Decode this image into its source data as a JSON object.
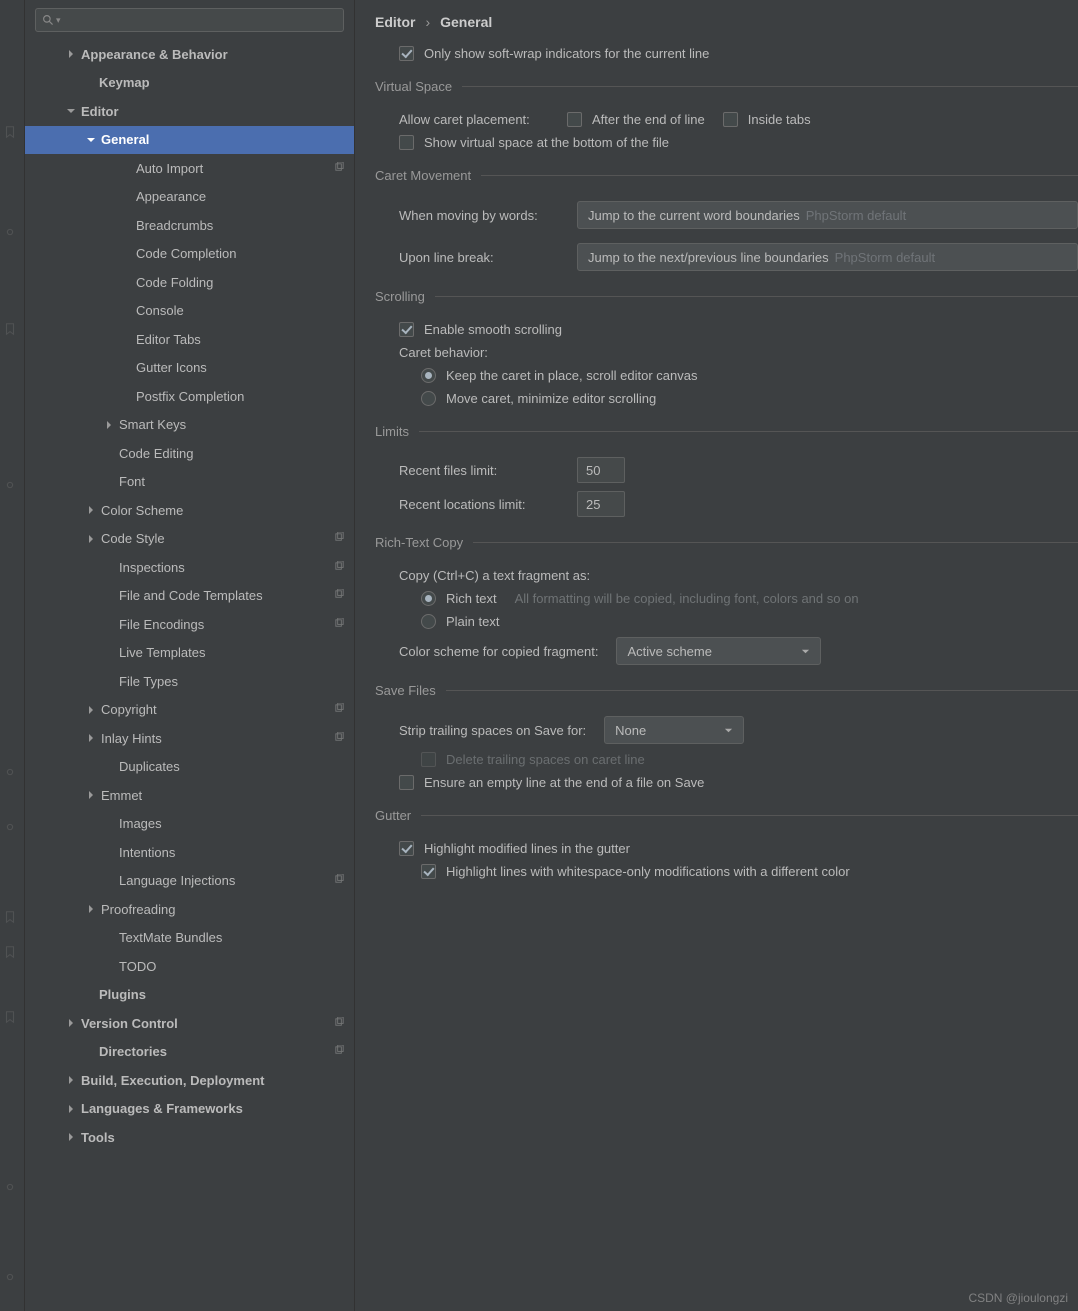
{
  "breadcrumb": {
    "a": "Editor",
    "sep": "›",
    "b": "General"
  },
  "top_checkbox": "Only show soft-wrap indicators for the current line",
  "sections": {
    "virtual_space": {
      "title": "Virtual Space",
      "allow_label": "Allow caret placement:",
      "after_eol": "After the end of line",
      "inside_tabs": "Inside tabs",
      "show_bottom": "Show virtual space at the bottom of the file"
    },
    "caret_movement": {
      "title": "Caret Movement",
      "by_words": "When moving by words:",
      "by_words_val": "Jump to the current word boundaries",
      "by_words_hint": "PhpStorm default",
      "line_break": "Upon line break:",
      "line_break_val": "Jump to the next/previous line boundaries",
      "line_break_hint": "PhpStorm default"
    },
    "scrolling": {
      "title": "Scrolling",
      "smooth": "Enable smooth scrolling",
      "behavior": "Caret behavior:",
      "keep": "Keep the caret in place, scroll editor canvas",
      "move": "Move caret, minimize editor scrolling"
    },
    "limits": {
      "title": "Limits",
      "recent_files": "Recent files limit:",
      "recent_files_val": "50",
      "recent_loc": "Recent locations limit:",
      "recent_loc_val": "25"
    },
    "rich": {
      "title": "Rich-Text Copy",
      "copy_as": "Copy (Ctrl+C) a text fragment as:",
      "rich": "Rich text",
      "rich_hint": "All formatting will be copied, including font, colors and so on",
      "plain": "Plain text",
      "scheme_label": "Color scheme for copied fragment:",
      "scheme_val": "Active scheme"
    },
    "save": {
      "title": "Save Files",
      "strip": "Strip trailing spaces on Save for:",
      "strip_val": "None",
      "del_caret": "Delete trailing spaces on caret line",
      "ensure": "Ensure an empty line at the end of a file on Save"
    },
    "gutter": {
      "title": "Gutter",
      "hl_mod": "Highlight modified lines in the gutter",
      "hl_ws": "Highlight lines with whitespace-only modifications with a different color"
    }
  },
  "tree": {
    "items": [
      {
        "label": "Appearance & Behavior",
        "indent": 40,
        "arrow": "r",
        "bold": true
      },
      {
        "label": "Keymap",
        "indent": 58,
        "bold": true
      },
      {
        "label": "Editor",
        "indent": 40,
        "arrow": "d",
        "bold": true
      },
      {
        "label": "General",
        "indent": 60,
        "arrow": "d",
        "bold": true,
        "selected": true
      },
      {
        "label": "Auto Import",
        "indent": 95,
        "copy": true
      },
      {
        "label": "Appearance",
        "indent": 95
      },
      {
        "label": "Breadcrumbs",
        "indent": 95
      },
      {
        "label": "Code Completion",
        "indent": 95
      },
      {
        "label": "Code Folding",
        "indent": 95
      },
      {
        "label": "Console",
        "indent": 95
      },
      {
        "label": "Editor Tabs",
        "indent": 95
      },
      {
        "label": "Gutter Icons",
        "indent": 95
      },
      {
        "label": "Postfix Completion",
        "indent": 95
      },
      {
        "label": "Smart Keys",
        "indent": 78,
        "arrow": "r"
      },
      {
        "label": "Code Editing",
        "indent": 78
      },
      {
        "label": "Font",
        "indent": 78
      },
      {
        "label": "Color Scheme",
        "indent": 60,
        "arrow": "r"
      },
      {
        "label": "Code Style",
        "indent": 60,
        "arrow": "r",
        "copy": true
      },
      {
        "label": "Inspections",
        "indent": 78,
        "copy": true
      },
      {
        "label": "File and Code Templates",
        "indent": 78,
        "copy": true
      },
      {
        "label": "File Encodings",
        "indent": 78,
        "copy": true
      },
      {
        "label": "Live Templates",
        "indent": 78
      },
      {
        "label": "File Types",
        "indent": 78
      },
      {
        "label": "Copyright",
        "indent": 60,
        "arrow": "r",
        "copy": true
      },
      {
        "label": "Inlay Hints",
        "indent": 60,
        "arrow": "r",
        "copy": true
      },
      {
        "label": "Duplicates",
        "indent": 78
      },
      {
        "label": "Emmet",
        "indent": 60,
        "arrow": "r"
      },
      {
        "label": "Images",
        "indent": 78
      },
      {
        "label": "Intentions",
        "indent": 78
      },
      {
        "label": "Language Injections",
        "indent": 78,
        "copy": true
      },
      {
        "label": "Proofreading",
        "indent": 60,
        "arrow": "r"
      },
      {
        "label": "TextMate Bundles",
        "indent": 78
      },
      {
        "label": "TODO",
        "indent": 78
      },
      {
        "label": "Plugins",
        "indent": 58,
        "bold": true
      },
      {
        "label": "Version Control",
        "indent": 40,
        "arrow": "r",
        "bold": true,
        "copy": true
      },
      {
        "label": "Directories",
        "indent": 58,
        "bold": true,
        "copy": true
      },
      {
        "label": "Build, Execution, Deployment",
        "indent": 40,
        "arrow": "r",
        "bold": true
      },
      {
        "label": "Languages & Frameworks",
        "indent": 40,
        "arrow": "r",
        "bold": true
      },
      {
        "label": "Tools",
        "indent": 40,
        "arrow": "r",
        "bold": true
      }
    ]
  },
  "watermark": "CSDN @jioulongzi"
}
